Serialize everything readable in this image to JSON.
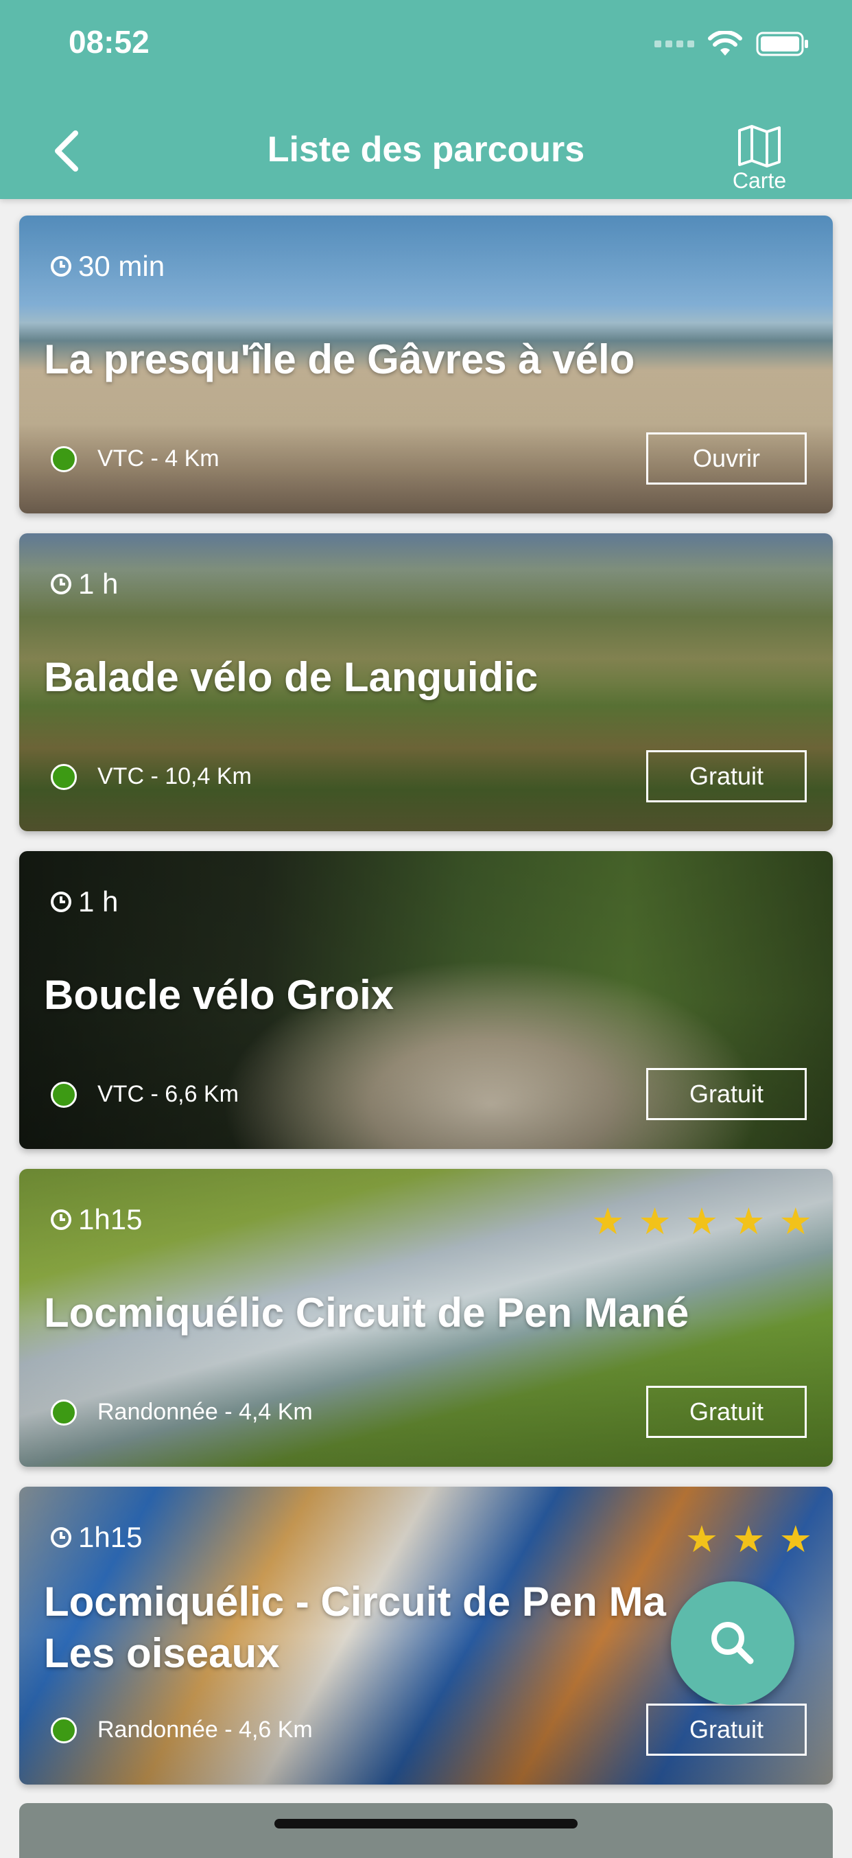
{
  "status": {
    "time": "08:52"
  },
  "header": {
    "title": "Liste des parcours",
    "map_label": "Carte"
  },
  "cards": [
    {
      "duration": "30 min",
      "title": "La presqu'île de Gâvres à vélo",
      "meta": "VTC - 4 Km",
      "action": "Ouvrir",
      "stars": 0
    },
    {
      "duration": "1 h",
      "title": "Balade vélo de Languidic",
      "meta": "VTC - 10,4 Km",
      "action": "Gratuit",
      "stars": 0
    },
    {
      "duration": "1 h",
      "title": "Boucle vélo Groix",
      "meta": "VTC - 6,6 Km",
      "action": "Gratuit",
      "stars": 0
    },
    {
      "duration": "1h15",
      "title": "Locmiquélic Circuit de Pen Mané",
      "meta": "Randonnée - 4,4 Km",
      "action": "Gratuit",
      "stars": 5
    },
    {
      "duration": "1h15",
      "title": "Locmiquélic - Circuit de Pen Ma Les oiseaux",
      "meta": "Randonnée - 4,6 Km",
      "action": "Gratuit",
      "stars": 3
    }
  ],
  "icons": {
    "back": "chevron-left-icon",
    "map": "map-icon",
    "clock": "clock-icon",
    "search": "search-icon",
    "star": "star-icon"
  },
  "colors": {
    "accent": "#5dbbab",
    "difficulty_dot": "#3d9a14",
    "star": "#f2c21a"
  }
}
